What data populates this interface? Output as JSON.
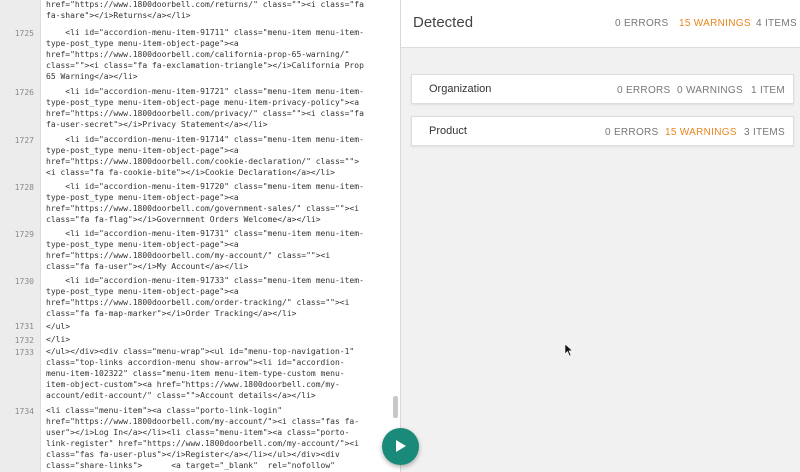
{
  "editor": {
    "line_numbers": [
      "1725",
      "1726",
      "1727",
      "1728",
      "1729",
      "1730",
      "1731",
      "1732",
      "1733",
      "1734"
    ],
    "lines": [
      "href=\"https://www.1800doorbell.com/returns/\" class=\"\"><i class=\"fa",
      "fa-share\"></i>Returns</a></li>",
      "    <li id=\"accordion-menu-item-91711\" class=\"menu-item menu-item-",
      "type-post_type menu-item-object-page\"><a",
      "href=\"https://www.1800doorbell.com/california-prop-65-warning/\"",
      "class=\"\"><i class=\"fa fa-exclamation-triangle\"></i>California Prop",
      "65 Warning</a></li>",
      "    <li id=\"accordion-menu-item-91721\" class=\"menu-item menu-item-",
      "type-post_type menu-item-object-page menu-item-privacy-policy\"><a",
      "href=\"https://www.1800doorbell.com/privacy/\" class=\"\"><i class=\"fa",
      "fa-user-secret\"></i>Privacy Statement</a></li>",
      "    <li id=\"accordion-menu-item-91714\" class=\"menu-item menu-item-",
      "type-post_type menu-item-object-page\"><a",
      "href=\"https://www.1800doorbell.com/cookie-declaration/\" class=\"\">",
      "<i class=\"fa fa-cookie-bite\"></i>Cookie Declaration</a></li>",
      "    <li id=\"accordion-menu-item-91720\" class=\"menu-item menu-item-",
      "type-post_type menu-item-object-page\"><a",
      "href=\"https://www.1800doorbell.com/government-sales/\" class=\"\"><i",
      "class=\"fa fa-flag\"></i>Government Orders Welcome</a></li>",
      "    <li id=\"accordion-menu-item-91731\" class=\"menu-item menu-item-",
      "type-post_type menu-item-object-page\"><a",
      "href=\"https://www.1800doorbell.com/my-account/\" class=\"\"><i",
      "class=\"fa fa-user\"></i>My Account</a></li>",
      "    <li id=\"accordion-menu-item-91733\" class=\"menu-item menu-item-",
      "type-post_type menu-item-object-page\"><a",
      "href=\"https://www.1800doorbell.com/order-tracking/\" class=\"\"><i",
      "class=\"fa fa-map-marker\"></i>Order Tracking</a></li>",
      "</ul>",
      "</li>",
      "</ul></div><div class=\"menu-wrap\"><ul id=\"menu-top-navigation-1\"",
      "class=\"top-links accordion-menu show-arrow\"><li id=\"accordion-",
      "menu-item-102322\" class=\"menu-item menu-item-type-custom menu-",
      "item-object-custom\"><a href=\"https://www.1800doorbell.com/my-",
      "account/edit-account/\" class=\"\">Account details</a></li>",
      "<li class=\"menu-item\"><a class=\"porto-link-login\"",
      "href=\"https://www.1800doorbell.com/my-account/\"><i class=\"fas fa-",
      "user\"></i>Log In</a></li><li class=\"menu-item\"><a class=\"porto-",
      "link-register\" href=\"https://www.1800doorbell.com/my-account/\"><i",
      "class=\"fas fa-user-plus\"></i>Register</a></li></ul></div><div",
      "class=\"share-links\">      <a target=\"_blank\"  rel=\"nofollow\""
    ]
  },
  "results": {
    "title": "Detected",
    "errors": "0 ERRORS",
    "warnings": "15 WARNINGS",
    "items": "4 ITEMS",
    "cards": [
      {
        "title": "Organization",
        "errors": "0 ERRORS",
        "warnings": "0 WARNINGS",
        "items": "1 ITEM"
      },
      {
        "title": "Product",
        "errors": "0 ERRORS",
        "warnings": "15 WARNINGS",
        "items": "3 ITEMS"
      }
    ]
  },
  "colors": {
    "warning": "#e8861f",
    "play_button": "#1a8a7a"
  },
  "icons": {
    "play": "play-icon",
    "cursor": "mouse-cursor-icon"
  }
}
